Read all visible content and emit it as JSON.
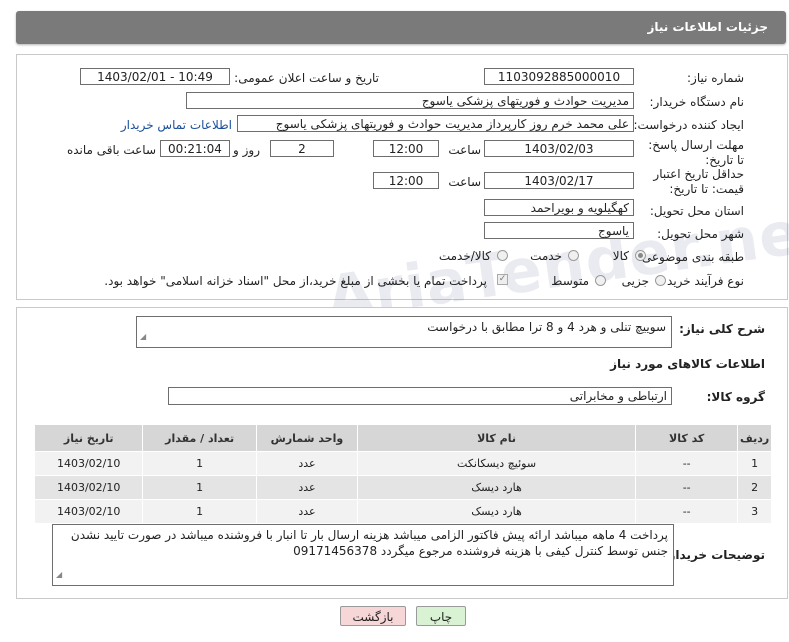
{
  "header": {
    "title": "جزئیات اطلاعات نیاز"
  },
  "form": {
    "need_number_label": "شماره نیاز:",
    "need_number": "1103092885000010",
    "announce_label": "تاریخ و ساعت اعلان عمومی:",
    "announce_value": "1403/02/01 - 10:49",
    "buyer_org_label": "نام دستگاه خریدار:",
    "buyer_org": "مدیریت حوادث و فوریتهای پزشکی یاسوج",
    "creator_label": "ایجاد کننده درخواست:",
    "creator": "علی محمد خرم روز کارپرداز مدیریت حوادث و فوریتهای پزشکی یاسوج",
    "contact_link": "اطلاعات تماس خریدار",
    "reply_deadline_label": "مهلت ارسال پاسخ: تا تاریخ:",
    "reply_date": "1403/02/03",
    "time_label": "ساعت",
    "reply_time": "12:00",
    "days_value": "2",
    "days_label": "روز و",
    "remaining_value": "00:21:04",
    "remaining_label": "ساعت باقی مانده",
    "validity_label": "حداقل تاریخ اعتبار قیمت: تا تاریخ:",
    "validity_date": "1403/02/17",
    "validity_time": "12:00",
    "province_label": "استان محل تحویل:",
    "province": "کهگیلویه و بویراحمد",
    "city_label": "شهر محل تحویل:",
    "city": "یاسوج",
    "category_label": "طبقه بندی موضوعی:",
    "category_options": [
      "کالا",
      "خدمت",
      "کالا/خدمت"
    ],
    "category_selected": "کالا",
    "process_label": "نوع فرآیند خرید :",
    "process_options": [
      "جزیی",
      "متوسط"
    ],
    "payment_note": "پرداخت تمام یا بخشی از مبلغ خرید،از محل \"اسناد خزانه اسلامی\" خواهد بود."
  },
  "description": {
    "label": "شرح کلی نیاز:",
    "value": "سوییچ تنلی و هرد 4 و 8 ترا مطابق با درخواست"
  },
  "goods": {
    "section_title": "اطلاعات کالاهای مورد نیاز",
    "group_label": "گروه کالا:",
    "group_value": "ارتباطی و مخابراتی",
    "columns": [
      "ردیف",
      "کد کالا",
      "نام کالا",
      "واحد شمارش",
      "تعداد / مقدار",
      "تاریخ نیاز"
    ],
    "rows": [
      {
        "idx": "1",
        "code": "--",
        "name": "سوئیچ دیسکانکت",
        "unit": "عدد",
        "qty": "1",
        "date": "1403/02/10"
      },
      {
        "idx": "2",
        "code": "--",
        "name": "هارد دیسک",
        "unit": "عدد",
        "qty": "1",
        "date": "1403/02/10"
      },
      {
        "idx": "3",
        "code": "--",
        "name": "هارد دیسک",
        "unit": "عدد",
        "qty": "1",
        "date": "1403/02/10"
      }
    ]
  },
  "buyer_notes": {
    "label": "توضیحات خریدار:",
    "value": "پرداخت 4 ماهه میباشد  ارائه پیش فاکتور الزامی میباشد  هزینه ارسال بار تا انبار  با فروشنده میباشد در صورت تایید نشدن جنس توسط کنترل کیفی با  هزینه فروشنده مرجوع میگردد 09171456378"
  },
  "buttons": {
    "print": "چاپ",
    "back": "بازگشت"
  },
  "watermark": "AriaTender.neT",
  "colors": {
    "header": "#7a7a7a",
    "link": "#1a4e9a",
    "back_button": "#f7d6d8",
    "print_button": "#d9f2d4"
  }
}
